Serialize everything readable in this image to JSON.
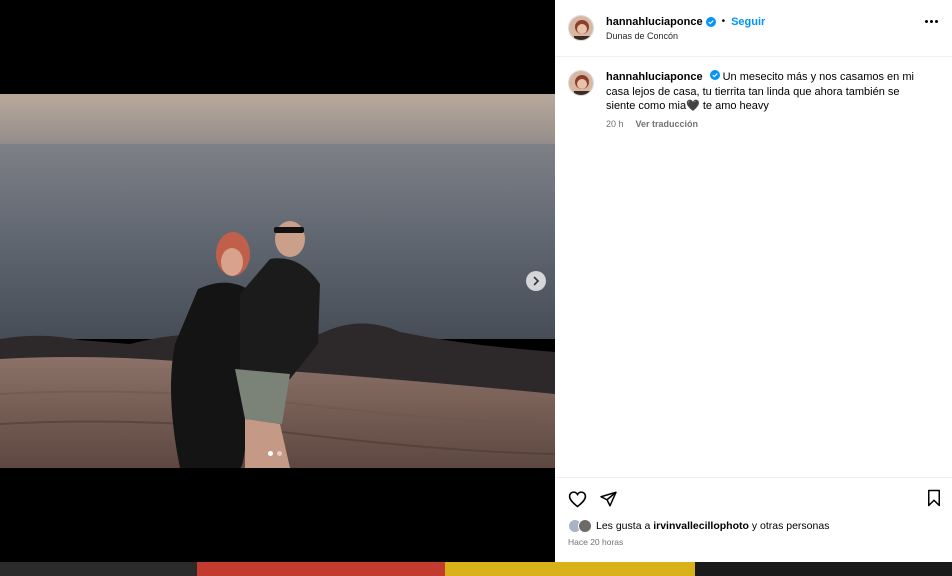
{
  "post": {
    "username": "hannahluciaponce",
    "separator": "•",
    "follow_label": "Seguir",
    "location": "Dunas de Concón",
    "caption": "Un mesecito más y nos casamos en mi casa lejos de casa, tu tierrita tan linda que ahora también se siente como mia🖤 te amo heavy",
    "caption_age": "20 h",
    "translate_label": "Ver traducción",
    "likes_prefix": "Les gusta a ",
    "likes_user": "irvinvallecillophoto",
    "likes_suffix": " y otras personas",
    "posted_time": "Hace 20 horas",
    "carousel_count": 2,
    "carousel_active": 0
  },
  "colors": {
    "accent": "#0095f6",
    "verified": "#0095f6",
    "muted": "#737373"
  },
  "icons": [
    "more-options-icon",
    "verified-icon",
    "heart-icon",
    "share-icon",
    "bookmark-icon",
    "chevron-right-icon"
  ]
}
